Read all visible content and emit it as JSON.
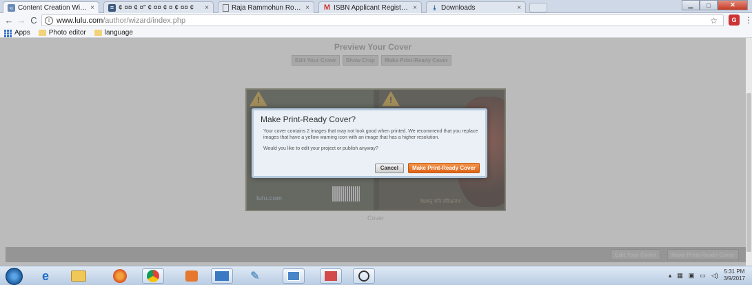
{
  "browser": {
    "tabs": [
      {
        "label": "Content Creation Wizard",
        "icon": "lulu-icon",
        "active": true
      },
      {
        "label": "¢ ¤¤ ¢ ¤\" ¢ ¤¤ ¢ ¤ ¢ ¤¤ ¢",
        "icon": "page-icon",
        "active": false
      },
      {
        "label": "Raja Rammohun Roy Na",
        "icon": "document-icon",
        "active": false
      },
      {
        "label": "ISBN Applicant Registrati",
        "icon": "gmail-icon",
        "active": false
      },
      {
        "label": "Downloads",
        "icon": "download-icon",
        "active": false
      },
      {
        "label": "",
        "icon": "",
        "active": false
      }
    ],
    "url_host": "www.lulu.com",
    "url_path": "/author/wizard/index.php",
    "extension_label": "G",
    "bookmarks": [
      {
        "label": "Apps"
      },
      {
        "label": "Photo editor"
      },
      {
        "label": "language"
      }
    ]
  },
  "page": {
    "title": "Preview Your Cover",
    "top_buttons": [
      "Edit Your Cover",
      "Show Crop",
      "Make Print-Ready Cover"
    ],
    "cover_caption": "Cover",
    "cover_logo": "lulu.com",
    "cover_text": "ইন্দ্রধনু কবি রবীন্দ্রনাথ",
    "bottom_buttons": [
      "Edit Your Cover",
      "Make Print-Ready Cover"
    ]
  },
  "modal": {
    "title": "Make Print-Ready Cover?",
    "paragraph1": "Your cover contains 2 images that may not look good when printed. We recommend that you replace images that have a yellow warning icon with an image that has a higher resolution.",
    "paragraph2": "Would you like to edit your project or publish anyway?",
    "cancel_label": "Cancel",
    "confirm_label": "Make Print-Ready Cover"
  },
  "taskbar": {
    "time": "5:31 PM",
    "date": "3/9/2017"
  },
  "colors": {
    "accent_orange": "#dd6317",
    "warning_yellow": "#c8a23a",
    "modal_bg": "#eaf0f6"
  }
}
